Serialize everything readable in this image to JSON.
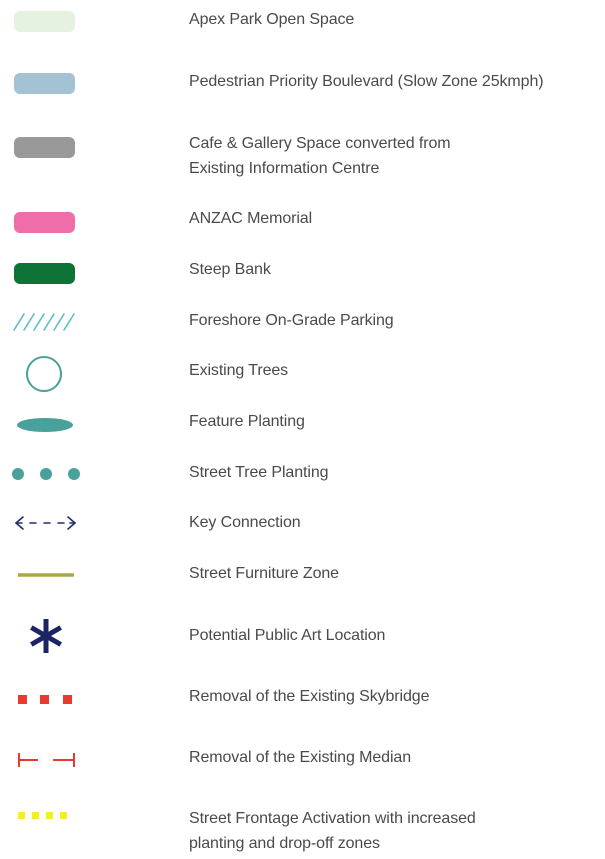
{
  "legend": {
    "items": [
      {
        "label": "Apex Park Open Space",
        "symbol": "pill",
        "color": "#e5f2e2"
      },
      {
        "label": "Pedestrian Priority Boulevard (Slow Zone 25kmph)",
        "symbol": "pill",
        "color": "#a3c3d4"
      },
      {
        "label": "Cafe & Gallery Space converted from",
        "label2": "Existing Information Centre",
        "symbol": "pill",
        "color": "#999999"
      },
      {
        "label": "ANZAC Memorial",
        "symbol": "pill",
        "color": "#ef6ea9"
      },
      {
        "label": "Steep Bank",
        "symbol": "pill",
        "color": "#0e7336"
      },
      {
        "label": "Foreshore On-Grade Parking",
        "symbol": "hatch",
        "color": "#5bbccd"
      },
      {
        "label": "Existing Trees",
        "symbol": "circle-outline",
        "color": "#4aa09a"
      },
      {
        "label": "Feature Planting",
        "symbol": "ellipse",
        "color": "#4aa09a"
      },
      {
        "label": "Street Tree Planting",
        "symbol": "dots",
        "color": "#4aa09a"
      },
      {
        "label": "Key Connection",
        "symbol": "dashed-double-arrow",
        "color": "#1f2f6e"
      },
      {
        "label": "Street Furniture Zone",
        "symbol": "line",
        "color": "#a8a84a"
      },
      {
        "label": "Potential Public Art Location",
        "symbol": "asterisk",
        "color": "#1c2466"
      },
      {
        "label": "Removal of the Existing Skybridge",
        "symbol": "red-squares",
        "color": "#e83a2e"
      },
      {
        "label": "Removal of the Existing Median",
        "symbol": "red-brackets",
        "color": "#e83a2e"
      },
      {
        "label": "Street Frontage Activation with increased",
        "label2": "planting and drop-off zones",
        "symbol": "yellow-squares",
        "color": "#f2ef2a"
      }
    ]
  }
}
